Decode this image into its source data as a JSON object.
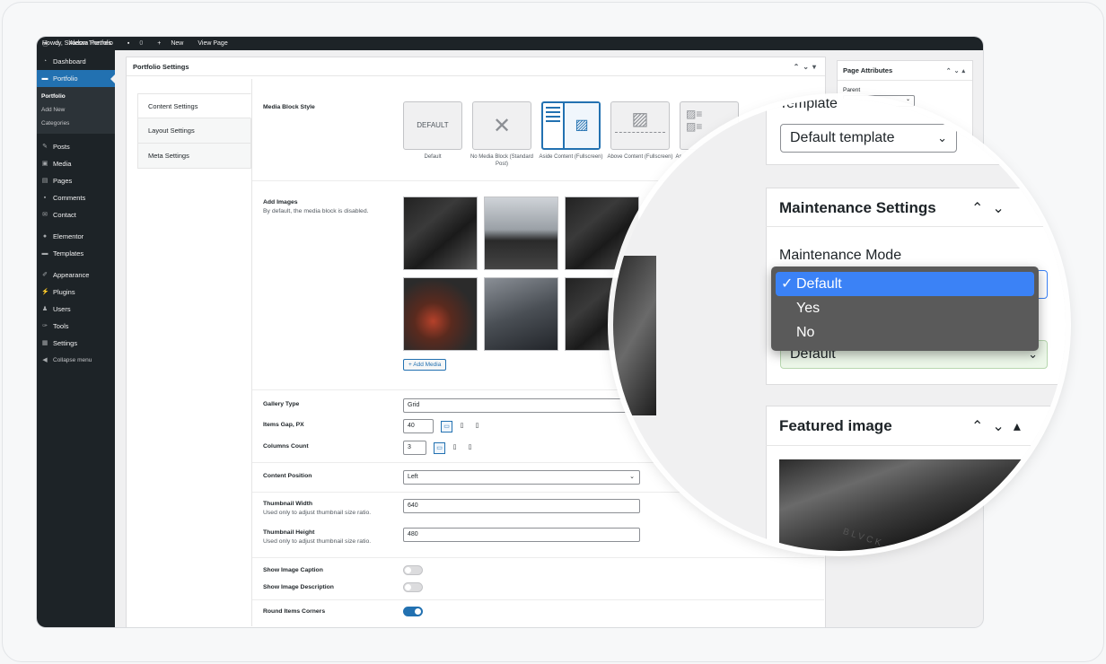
{
  "adminbar": {
    "site": "Alessa Portfolio",
    "comments": "0",
    "new": "New",
    "view": "View Page",
    "howdy": "Howdy, Shadow Themes"
  },
  "sidebar": {
    "items": [
      {
        "label": "Dashboard",
        "icon": "dashboard-icon"
      },
      {
        "label": "Portfolio",
        "icon": "folder-icon"
      },
      {
        "label": "Posts",
        "icon": "pin-icon"
      },
      {
        "label": "Media",
        "icon": "media-icon"
      },
      {
        "label": "Pages",
        "icon": "page-icon"
      },
      {
        "label": "Comments",
        "icon": "comment-icon"
      },
      {
        "label": "Contact",
        "icon": "mail-icon"
      },
      {
        "label": "Elementor",
        "icon": "elementor-icon"
      },
      {
        "label": "Templates",
        "icon": "folder-icon"
      },
      {
        "label": "Appearance",
        "icon": "brush-icon"
      },
      {
        "label": "Plugins",
        "icon": "plugin-icon"
      },
      {
        "label": "Users",
        "icon": "user-icon"
      },
      {
        "label": "Tools",
        "icon": "wrench-icon"
      },
      {
        "label": "Settings",
        "icon": "settings-icon"
      },
      {
        "label": "Collapse menu",
        "icon": "collapse-icon"
      }
    ],
    "submenu": [
      "Portfolio",
      "Add New",
      "Categories"
    ]
  },
  "portfolio_settings": {
    "title": "Portfolio Settings",
    "tabs": [
      "Content Settings",
      "Layout Settings",
      "Meta Settings"
    ],
    "media_block_style": {
      "label": "Media Block Style",
      "options": [
        {
          "label": "Default",
          "box": "DEFAULT"
        },
        {
          "label": "No Media Block (Standard Post)"
        },
        {
          "label": "Aside Content (Fullscreen)"
        },
        {
          "label": "Above Content (Fullscreen)"
        },
        {
          "label": "As"
        }
      ]
    },
    "add_images": {
      "label": "Add Images",
      "desc": "By default, the media block is disabled.",
      "button": "+ Add Media"
    },
    "gallery_type": {
      "label": "Gallery Type",
      "value": "Grid"
    },
    "items_gap": {
      "label": "Items Gap, PX",
      "value": "40"
    },
    "columns_count": {
      "label": "Columns Count",
      "value": "3"
    },
    "content_position": {
      "label": "Content Position",
      "value": "Left"
    },
    "thumb_width": {
      "label": "Thumbnail Width",
      "desc": "Used only to adjust thumbnail size ratio.",
      "value": "640"
    },
    "thumb_height": {
      "label": "Thumbnail Height",
      "desc": "Used only to adjust thumbnail size ratio.",
      "value": "480"
    },
    "show_caption": {
      "label": "Show Image Caption",
      "on": false
    },
    "show_description": {
      "label": "Show Image Description",
      "on": false
    },
    "round_corners": {
      "label": "Round Items Corners",
      "on": true
    }
  },
  "page_attributes": {
    "title": "Page Attributes",
    "parent_label": "Parent"
  },
  "zoom": {
    "template_label": "Template",
    "template_value": "Default template",
    "maintenance_title": "Maintenance Settings",
    "maintenance_label": "Maintenance Mode",
    "dropdown_options": [
      "Default",
      "Yes",
      "No"
    ],
    "dropdown_selected": "Default",
    "below_value": "Default",
    "featured_title": "Featured image",
    "watermark": "BLVCK"
  }
}
